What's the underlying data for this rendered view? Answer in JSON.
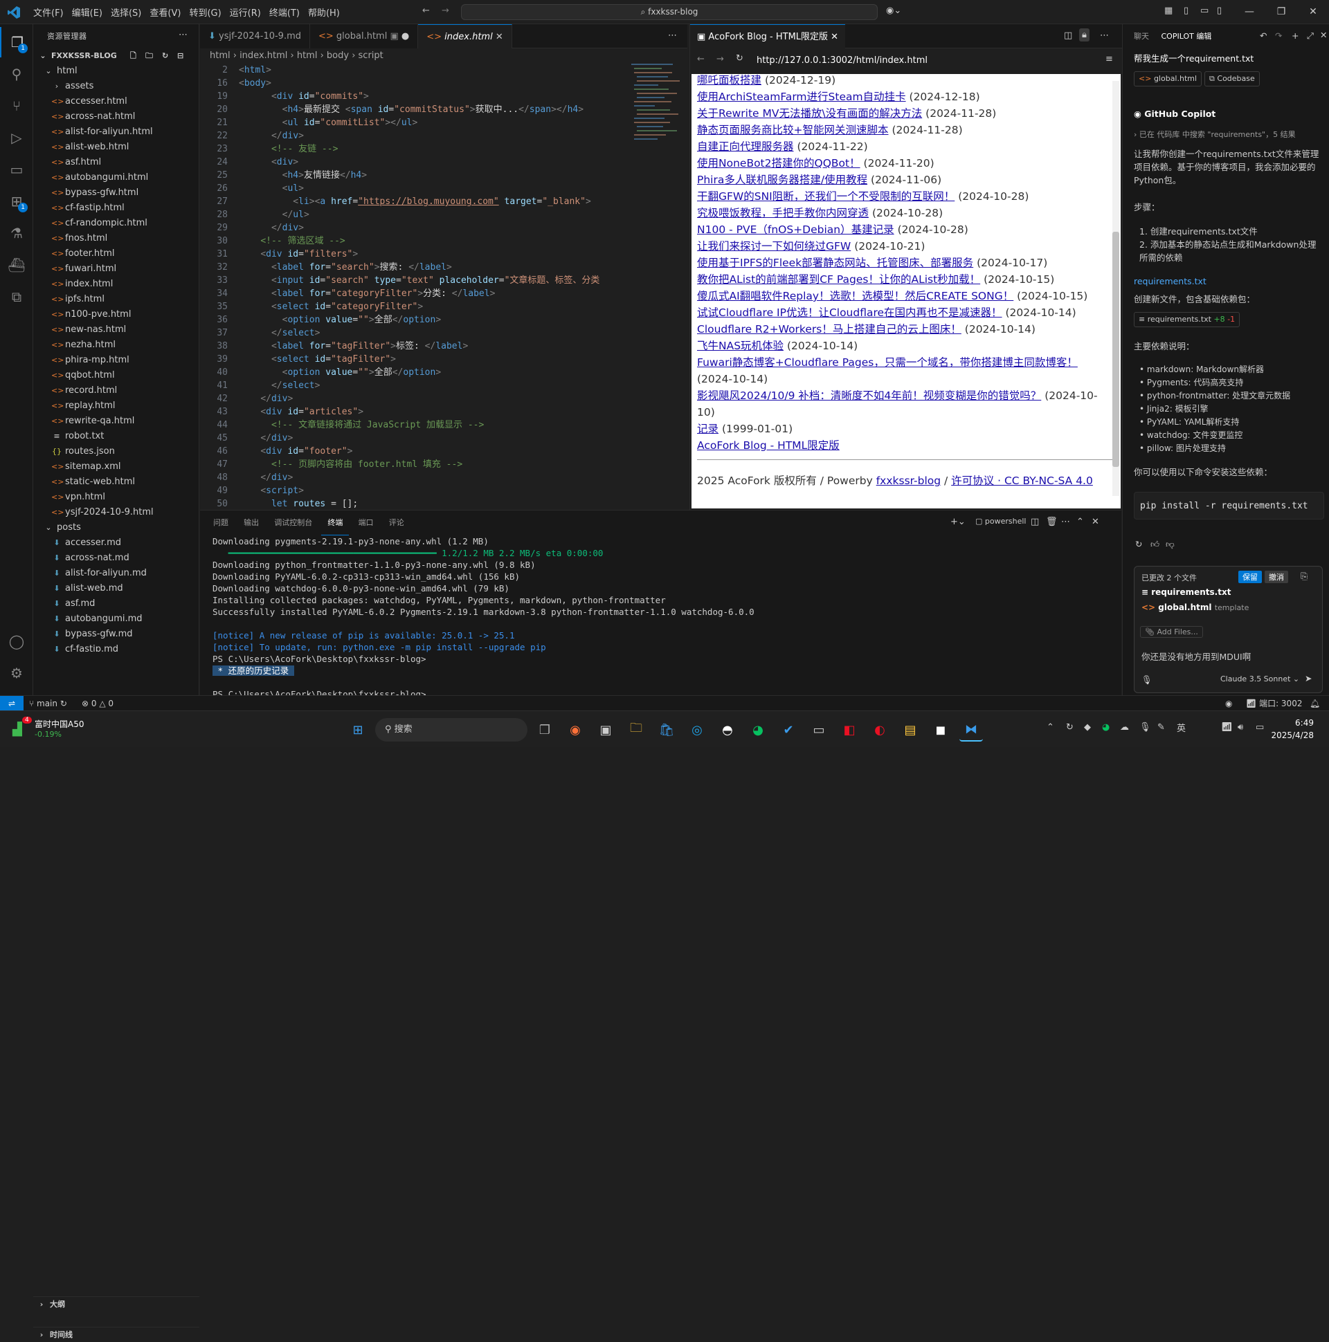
{
  "titlebar": {
    "menus": [
      "文件(F)",
      "编辑(E)",
      "选择(S)",
      "查看(V)",
      "转到(G)",
      "运行(R)",
      "终端(T)",
      "帮助(H)"
    ],
    "command_center": "fxxkssr-blog"
  },
  "explorer": {
    "header": "资源管理器",
    "root": "FXXKSSR-BLOG",
    "folder_html": "html",
    "html_items": [
      "assets",
      "accesser.html",
      "across-nat.html",
      "alist-for-aliyun.html",
      "alist-web.html",
      "asf.html",
      "autobangumi.html",
      "bypass-gfw.html",
      "cf-fastip.html",
      "cf-randompic.html",
      "fnos.html",
      "footer.html",
      "fuwari.html",
      "index.html",
      "ipfs.html",
      "n100-pve.html",
      "new-nas.html",
      "nezha.html",
      "phira-mp.html",
      "qqbot.html",
      "record.html",
      "replay.html",
      "rewrite-qa.html",
      "robot.txt",
      "routes.json",
      "sitemap.xml",
      "static-web.html",
      "vpn.html",
      "ysjf-2024-10-9.html"
    ],
    "folder_posts": "posts",
    "posts_items": [
      "accesser.md",
      "across-nat.md",
      "alist-for-aliyun.md",
      "alist-web.md",
      "asf.md",
      "autobangumi.md",
      "bypass-gfw.md",
      "cf-fastip.md",
      "cf-randompic.md"
    ],
    "outline": "大纲",
    "timeline": "时间线"
  },
  "editor": {
    "tabs": [
      "ysjf-2024-10-9.md",
      "global.html",
      "index.html"
    ],
    "breadcrumb": "html › index.html › html › body › script"
  },
  "browser": {
    "tab_title": "AcoFork Blog - HTML限定版",
    "url": "http://127.0.0.1:3002/html/index.html",
    "articles": [
      {
        "t": "哪吒面板搭建",
        "d": "(2024-12-19)"
      },
      {
        "t": "使用ArchiSteamFarm进行Steam自动挂卡",
        "d": "(2024-12-18)"
      },
      {
        "t": "关于Rewrite MV无法播放\\没有画面的解决方法",
        "d": "(2024-11-28)"
      },
      {
        "t": "静态页面服务商比较+智能网关测速脚本",
        "d": "(2024-11-28)"
      },
      {
        "t": "自建正向代理服务器",
        "d": "(2024-11-22)"
      },
      {
        "t": "使用NoneBot2搭建你的QQBot！",
        "d": "(2024-11-20)"
      },
      {
        "t": "Phira多人联机服务器搭建/使用教程",
        "d": "(2024-11-06)"
      },
      {
        "t": "干翻GFW的SNI阻断，还我们一个不受限制的互联网！",
        "d": "(2024-10-28)"
      },
      {
        "t": "究极喂饭教程，手把手教你内网穿透",
        "d": "(2024-10-28)"
      },
      {
        "t": "N100 - PVE（fnOS+Debian）基建记录",
        "d": "(2024-10-28)"
      },
      {
        "t": "让我们来探讨一下如何绕过GFW",
        "d": "(2024-10-21)"
      },
      {
        "t": "使用基于IPFS的Fleek部署静态网站、托管图床、部署服务",
        "d": "(2024-10-17)"
      },
      {
        "t": "教你把AList的前端部署到CF Pages！让你的AList秒加载！",
        "d": "(2024-10-15)"
      },
      {
        "t": "傻瓜式AI翻唱软件Replay！选歌！选模型！然后CREATE SONG！",
        "d": "(2024-10-15)"
      },
      {
        "t": "试试Cloudflare IP优选！让Cloudflare在国内再也不是减速器！",
        "d": "(2024-10-14)"
      },
      {
        "t": "Cloudflare R2+Workers！马上搭建自己的云上图床！",
        "d": "(2024-10-14)"
      },
      {
        "t": "飞牛NAS玩机体验",
        "d": "(2024-10-14)"
      },
      {
        "t": "Fuwari静态博客+Cloudflare Pages，只需一个域名，带你搭建博主同款博客！",
        "d": "(2024-10-14)"
      },
      {
        "t": "影视飓风2024/10/9 补档：清晰度不如4年前！视频变糊是你的错觉吗？",
        "d": "(2024-10-10)"
      },
      {
        "t": "记录",
        "d": "(1999-01-01)"
      }
    ],
    "home_link": "AcoFork Blog - HTML限定版",
    "footer_prefix": "2025 AcoFork 版权所有 / Powerby ",
    "footer_link1": "fxxkssr-blog",
    "footer_sep": " / ",
    "footer_link2": "许可协议 · CC BY-NC-SA 4.0"
  },
  "panel": {
    "tabs": [
      "问题",
      "输出",
      "调试控制台",
      "终端",
      "端口",
      "评论"
    ],
    "shell": "powershell",
    "lines": [
      "Downloading pygments-2.19.1-py3-none-any.whl (1.2 MB)",
      "   ━━━━━━━━━━━━━━━━━━━━━━━━━━━━━━━━━━━━━━━━ 1.2/1.2 MB 2.2 MB/s eta 0:00:00",
      "Downloading python_frontmatter-1.1.0-py3-none-any.whl (9.8 kB)",
      "Downloading PyYAML-6.0.2-cp313-cp313-win_amd64.whl (156 kB)",
      "Downloading watchdog-6.0.0-py3-none-win_amd64.whl (79 kB)",
      "Installing collected packages: watchdog, PyYAML, Pygments, markdown, python-frontmatter",
      "Successfully installed PyYAML-6.0.2 Pygments-2.19.1 markdown-3.8 python-frontmatter-1.1.0 watchdog-6.0.0",
      "",
      "[notice] A new release of pip is available: 25.0.1 -> 25.1",
      "[notice] To update, run: python.exe -m pip install --upgrade pip",
      "PS C:\\Users\\AcoFork\\Desktop\\fxxkssr-blog>",
      " * 还原的历史记录 ",
      "",
      "PS C:\\Users\\AcoFork\\Desktop\\fxxkssr-blog>"
    ]
  },
  "copilot": {
    "tabs": [
      "聊天",
      "COPILOT 编辑"
    ],
    "prompt": "帮我生成一个requirement.txt",
    "chips": [
      "global.html",
      "Codebase"
    ],
    "name": "GitHub Copilot",
    "search": "已在 代码库 中搜索 \"requirements\"，5 结果",
    "intro": "让我帮你创建一个requirements.txt文件来管理项目依赖。基于你的博客项目，我会添加必要的Python包。",
    "steps_title": "步骤：",
    "steps": [
      "创建requirements.txt文件",
      "添加基本的静态站点生成和Markdown处理所需的依赖"
    ],
    "file_link": "requirements.txt",
    "new_file_text": "创建新文件，包含基础依赖包：",
    "file_chip": "requirements.txt",
    "diff_plus": "+8",
    "diff_minus": "-1",
    "deps_title": "主要依赖说明：",
    "deps": [
      "markdown: Markdown解析器",
      "Pygments: 代码高亮支持",
      "python-frontmatter: 处理文章元数据",
      "Jinja2: 模板引擎",
      "PyYAML: YAML解析支持",
      "watchdog: 文件变更监控",
      "pillow: 图片处理支持"
    ],
    "install_text": "你可以使用以下命令安装这些依赖：",
    "install_cmd": "pip install -r requirements.txt",
    "changed": "已更改 2 个文件",
    "keep": "保留",
    "undo": "撤消",
    "changed_files": [
      "requirements.txt",
      "global.html"
    ],
    "template": "template",
    "add_files": "Add Files...",
    "input": "你还是没有地方用到MDUI啊",
    "model": "Claude 3.5 Sonnet"
  },
  "status": {
    "branch": "main",
    "errors": "0",
    "warnings": "0",
    "port": "端口: 3002"
  },
  "taskbar": {
    "stock_name": "富时中国A50",
    "stock_change": "-0.19%",
    "badge": "4",
    "search": "搜索",
    "ime": "英",
    "time": "6:49",
    "date": "2025/4/28"
  }
}
